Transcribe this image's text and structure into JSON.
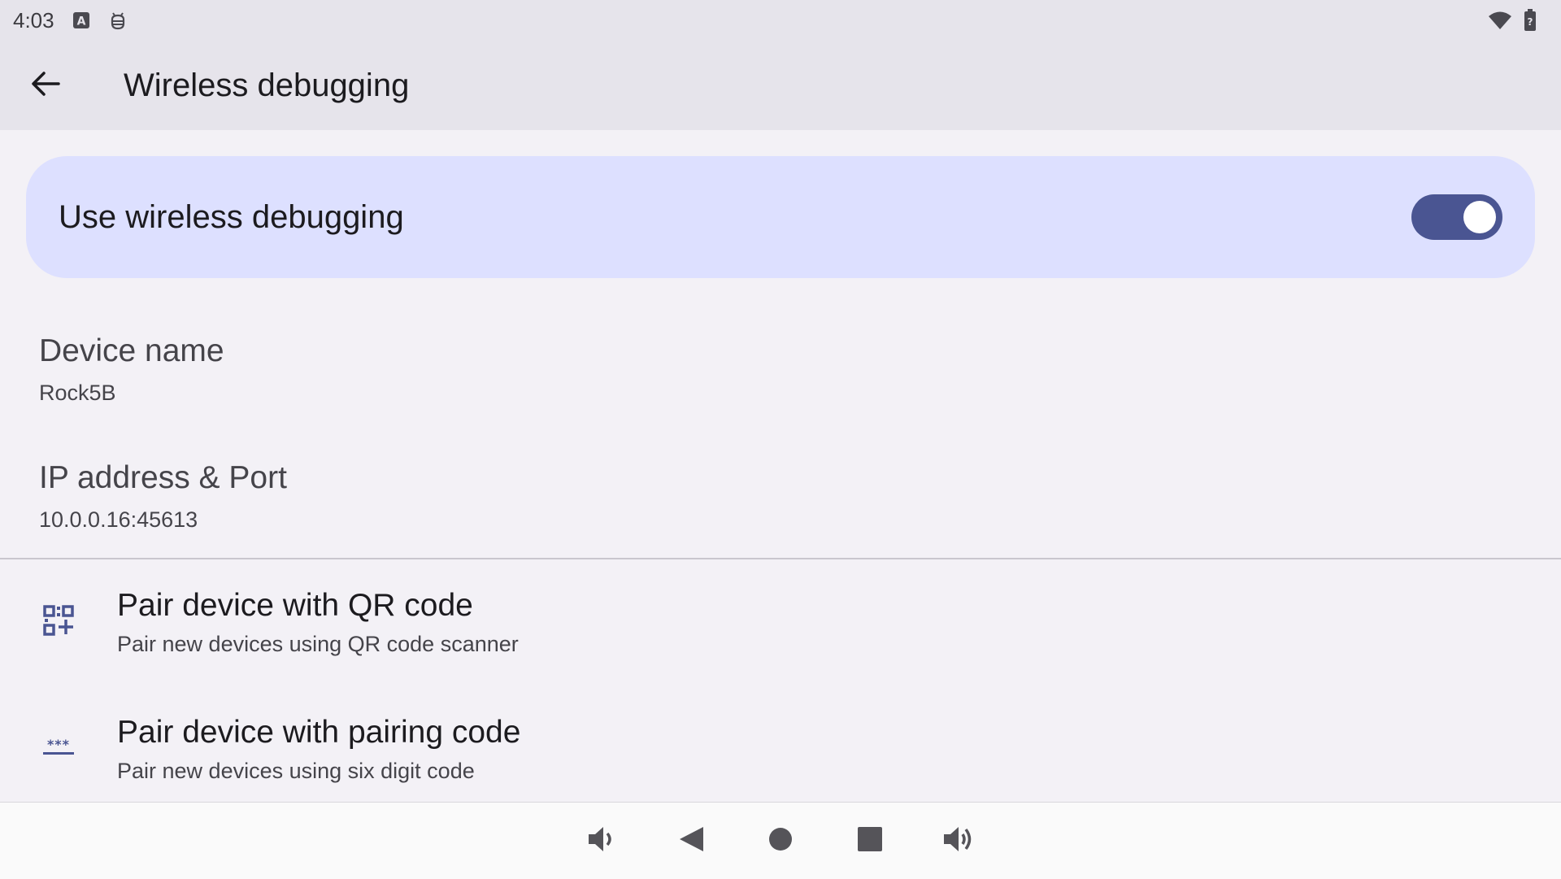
{
  "status_bar": {
    "time": "4:03",
    "left_icons": [
      "keyboard-a-icon",
      "debug-icon"
    ],
    "right_icons": [
      "wifi-icon",
      "battery-unknown-icon"
    ]
  },
  "app_bar": {
    "back_icon": "arrow-back-icon",
    "title": "Wireless debugging"
  },
  "main_switch": {
    "label": "Use wireless debugging",
    "checked": true,
    "accent_color": "#4a5592",
    "background_color": "#dde0ff"
  },
  "preferences": {
    "device_name": {
      "title": "Device name",
      "summary": "Rock5B"
    },
    "ip_address": {
      "title": "IP address & Port",
      "summary": "10.0.0.16:45613"
    },
    "pair_qr": {
      "icon": "qr-code-scanner-icon",
      "title": "Pair device with QR code",
      "summary": "Pair new devices using QR code scanner"
    },
    "pair_code": {
      "icon": "password-dots-icon",
      "title": "Pair device with pairing code",
      "summary": "Pair new devices using six digit code"
    }
  },
  "nav_bar": {
    "buttons": [
      "volume-down-icon",
      "back-triangle-icon",
      "home-circle-icon",
      "recents-square-icon",
      "volume-up-icon"
    ]
  }
}
